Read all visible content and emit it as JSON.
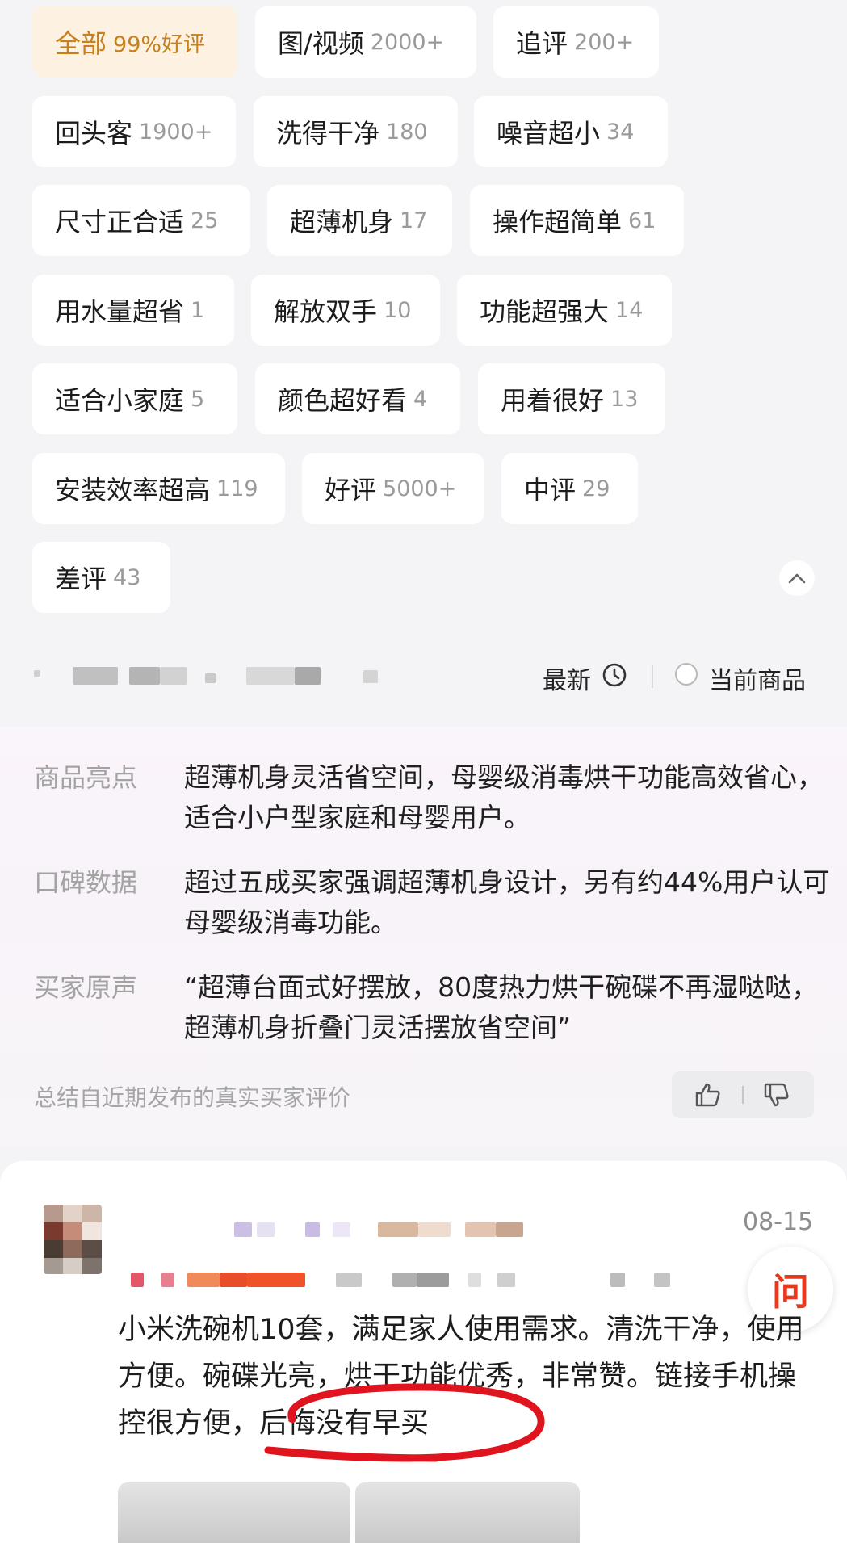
{
  "filters": [
    {
      "label": "全部",
      "count": "99%好评",
      "active": true
    },
    {
      "label": "图/视频",
      "count": "2000+"
    },
    {
      "label": "追评",
      "count": "200+"
    },
    {
      "label": "回头客",
      "count": "1900+"
    },
    {
      "label": "洗得干净",
      "count": "180"
    },
    {
      "label": "噪音超小",
      "count": "34"
    },
    {
      "label": "尺寸正合适",
      "count": "25"
    },
    {
      "label": "超薄机身",
      "count": "17"
    },
    {
      "label": "操作超简单",
      "count": "61"
    },
    {
      "label": "用水量超省",
      "count": "1"
    },
    {
      "label": "解放双手",
      "count": "10"
    },
    {
      "label": "功能超强大",
      "count": "14"
    },
    {
      "label": "适合小家庭",
      "count": "5"
    },
    {
      "label": "颜色超好看",
      "count": "4"
    },
    {
      "label": "用着很好",
      "count": "13"
    },
    {
      "label": "安装效率超高",
      "count": "119"
    },
    {
      "label": "好评",
      "count": "5000+"
    },
    {
      "label": "中评",
      "count": "29"
    },
    {
      "label": "差评",
      "count": "43"
    }
  ],
  "sort": {
    "latest": "最新",
    "current_product": "当前商品"
  },
  "summary": {
    "rows": [
      {
        "key": "商品亮点",
        "value": "超薄机身灵活省空间，母婴级消毒烘干功能高效省心，适合小户型家庭和母婴用户。"
      },
      {
        "key": "口碑数据",
        "value": "超过五成买家强调超薄机身设计，另有约44%用户认可母婴级消毒功能。"
      },
      {
        "key": "买家原声",
        "value": "“超薄台面式好摆放，80度热力烘干碗碟不再湿哒哒，超薄机身折叠门灵活摆放省空间”"
      }
    ],
    "footnote": "总结自近期发布的真实买家评价"
  },
  "review": {
    "date": "08-15",
    "ask_label": "问",
    "text_main": "小米洗碗机10套，满足家人使用需求。清洗干净，使用方便。碗碟光亮，烘干功能优秀，非常赞。链接手机操控很方便，",
    "text_highlight": "后悔没有早买"
  },
  "colors": {
    "accent": "#c8801c",
    "active_bg": "#fdf1e1",
    "ask_red": "#e8391d",
    "annotation_red": "#e0141e"
  }
}
